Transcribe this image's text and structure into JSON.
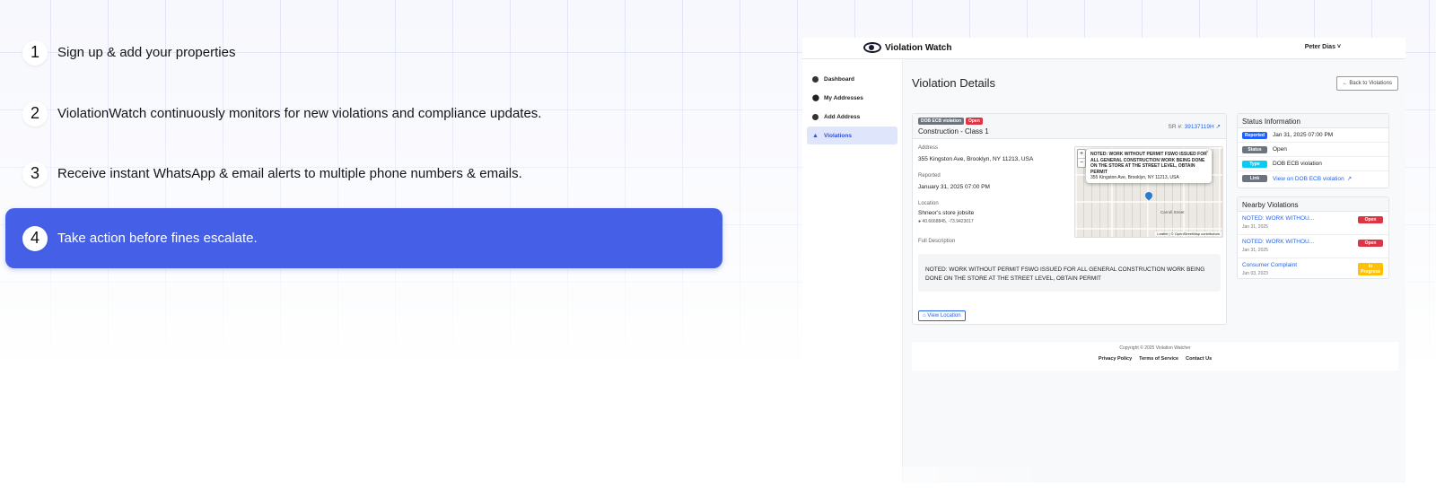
{
  "steps": [
    {
      "num": "1",
      "text": "Sign up & add your properties"
    },
    {
      "num": "2",
      "text": "ViolationWatch continuously monitors for new violations and compliance updates."
    },
    {
      "num": "3",
      "text": "Receive instant WhatsApp & email alerts to multiple phone numbers & emails."
    },
    {
      "num": "4",
      "text": "Take action before fines escalate."
    }
  ],
  "app": {
    "brand": "Violation Watch",
    "user": "Peter Dias ˅",
    "nav": [
      {
        "label": "Dashboard",
        "icon": "dashboard-icon"
      },
      {
        "label": "My Addresses",
        "icon": "location-pin-icon"
      },
      {
        "label": "Add Address",
        "icon": "plus-circle-icon"
      },
      {
        "label": "Violations",
        "icon": "warning-triangle-icon"
      }
    ],
    "page_title": "Violation Details",
    "back_button": "← Back to Violations",
    "detail": {
      "badge_type": "DOB ECB violation",
      "badge_status": "Open",
      "title": "Construction - Class 1",
      "sr_label": "SR #:",
      "sr_number": "39137119H",
      "address_label": "Address",
      "address": "355 Kingston Ave, Brooklyn, NY 11213, USA",
      "reported_label": "Reported",
      "reported": "January 31, 2025 07:00 PM",
      "location_label": "Location",
      "location": "Shneor's store jobsite",
      "coords": "40.6668845, -73.9423017",
      "full_desc_label": "Full Description",
      "full_desc": "NOTED: WORK WITHOUT PERMIT FSWO ISSUED FOR ALL GENERAL CONSTRUCTION WORK BEING DONE ON THE STORE AT THE STREET LEVEL, OBTAIN PERMIT",
      "view_location": "View Location",
      "map": {
        "popup_title": "NOTED: WORK WITHOUT PERMIT FSWO ISSUED FOR ALL GENERAL CONSTRUCTION WORK BEING DONE ON THE STORE AT THE STREET LEVEL, OBTAIN PERMIT",
        "popup_address": "355 Kingston Ave, Brooklyn, NY 11213, USA",
        "zoom_in": "+",
        "zoom_out": "−",
        "close": "×",
        "street": "Carroll Street",
        "attribution": "Leaflet | © OpenStreetMap contributors"
      }
    },
    "status": {
      "title": "Status Information",
      "rows": [
        {
          "badge": "Reported",
          "badge_color": "#1f5fff",
          "value": "Jan 31, 2025 07:00 PM"
        },
        {
          "badge": "Status",
          "badge_color": "#6c757d",
          "value": "Open"
        },
        {
          "badge": "Type",
          "badge_color": "#0dcaf0",
          "value": "DOB ECB violation"
        },
        {
          "badge": "Link",
          "badge_color": "#6c757d",
          "value": "View on DOB ECB violation"
        }
      ]
    },
    "nearby": {
      "title": "Nearby Violations",
      "items": [
        {
          "title": "NOTED: WORK WITHOU...",
          "date": "Jan 31, 2025",
          "badge": "Open"
        },
        {
          "title": "NOTED: WORK WITHOU...",
          "date": "Jan 31, 2025",
          "badge": "Open"
        },
        {
          "title": "Consumer Complaint",
          "date": "Jun 03, 2023",
          "badge": "In Progress"
        }
      ]
    },
    "footer": {
      "copyright": "Copyright © 2025 Violation Watcher",
      "privacy": "Privacy Policy",
      "terms": "Terms of Service",
      "contact": "Contact Us"
    }
  },
  "colors": {
    "accent": "#4560e6",
    "link": "#2563eb",
    "danger": "#dc3545",
    "warning": "#ffc107"
  }
}
